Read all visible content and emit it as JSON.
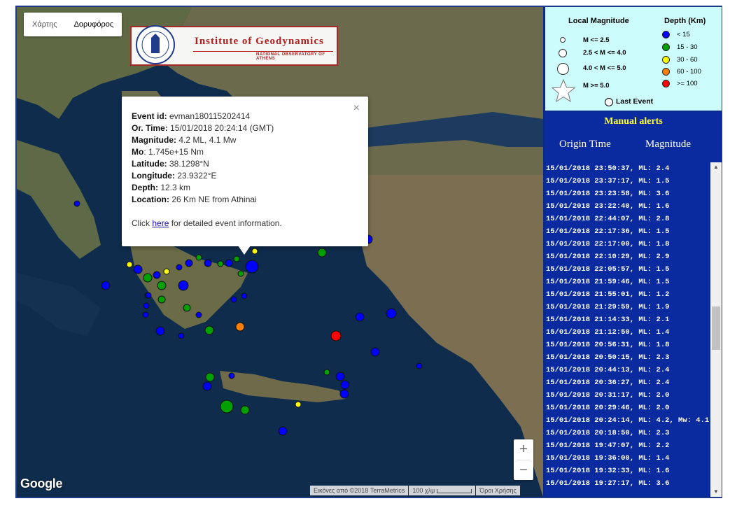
{
  "map": {
    "type_buttons": [
      "Χάρτης",
      "Δορυφόρος"
    ],
    "logo_title": "Institute of Geodynamics",
    "logo_subtitle": "NATIONAL OBSERVATORY OF ATHENS",
    "zoom_in": "+",
    "zoom_out": "−",
    "google": "Google",
    "attribution": [
      "Εικόνες από ©2018 TerraMetrics",
      "100 χλμ",
      "Όροι Χρήσης"
    ]
  },
  "popup": {
    "close": "×",
    "rows": [
      {
        "label": "Event id:",
        "value": " evman180115202414"
      },
      {
        "label": "Or. Time:",
        "value": " 15/01/2018  20:24:14 (GMT)"
      },
      {
        "label": "Magnitude:",
        "value": " 4.2 ML, 4.1 Mw"
      },
      {
        "label": "Mo",
        "value": ": 1.745e+15 Nm"
      },
      {
        "label": "Latitude:",
        "value": " 38.1298°N"
      },
      {
        "label": "Longitude:",
        "value": " 23.9322°E"
      },
      {
        "label": "Depth:",
        "value": " 12.3 km"
      },
      {
        "label": "Location:",
        "value": " 26 Km NE from Athinai"
      }
    ],
    "click_pre": "Click ",
    "click_link": "here",
    "click_post": " for detailed event information."
  },
  "legend": {
    "mag_title": "Local Magnitude",
    "depth_title": "Depth (Km)",
    "mag_items": [
      "M <= 2.5",
      "2.5 < M <= 4.0",
      "4.0 < M <= 5.0",
      "M >= 5.0"
    ],
    "depth_items": [
      {
        "label": "< 15",
        "color": "#0000ff"
      },
      {
        "label": "15 - 30",
        "color": "#00a000"
      },
      {
        "label": "30 - 60",
        "color": "#ffff00"
      },
      {
        "label": "60 - 100",
        "color": "#ff8000"
      },
      {
        "label": ">= 100",
        "color": "#ff0000"
      }
    ],
    "last_event": "Last Event"
  },
  "alerts": {
    "title": "Manual alerts",
    "col_time": "Origin Time",
    "col_mag": "Magnitude",
    "items": [
      "15/01/2018  23:50:37,  ML: 2.4",
      "15/01/2018  23:37:17,  ML: 1.5",
      "15/01/2018  23:23:58,  ML: 3.6",
      "15/01/2018  23:22:40,  ML: 1.6",
      "15/01/2018  22:44:07,  ML: 2.8",
      "15/01/2018  22:17:36,  ML: 1.5",
      "15/01/2018  22:17:00,  ML: 1.8",
      "15/01/2018  22:10:29,  ML: 2.9",
      "15/01/2018  22:05:57,  ML: 1.5",
      "15/01/2018  21:59:46,  ML: 1.5",
      "15/01/2018  21:55:01,  ML: 1.2",
      "15/01/2018  21:29:59,  ML: 1.9",
      "15/01/2018  21:14:33,  ML: 2.1",
      "15/01/2018  21:12:50,  ML: 1.4",
      "15/01/2018  20:56:31,  ML: 1.8",
      "15/01/2018  20:50:15,  ML: 2.3",
      "15/01/2018  20:44:13,  ML: 2.4",
      "15/01/2018  20:36:27,  ML: 2.4",
      "15/01/2018  20:31:17,  ML: 2.0",
      "15/01/2018  20:29:46,  ML: 2.0",
      "15/01/2018  20:24:14,  ML: 4.2, Mw: 4.1",
      "15/01/2018  20:18:50,  ML: 2.3",
      "15/01/2018  19:47:07,  ML: 2.2",
      "15/01/2018  19:36:00,  ML: 1.4",
      "15/01/2018  19:32:33,  ML: 1.6",
      "15/01/2018  19:27:17,  ML: 3.6"
    ]
  }
}
